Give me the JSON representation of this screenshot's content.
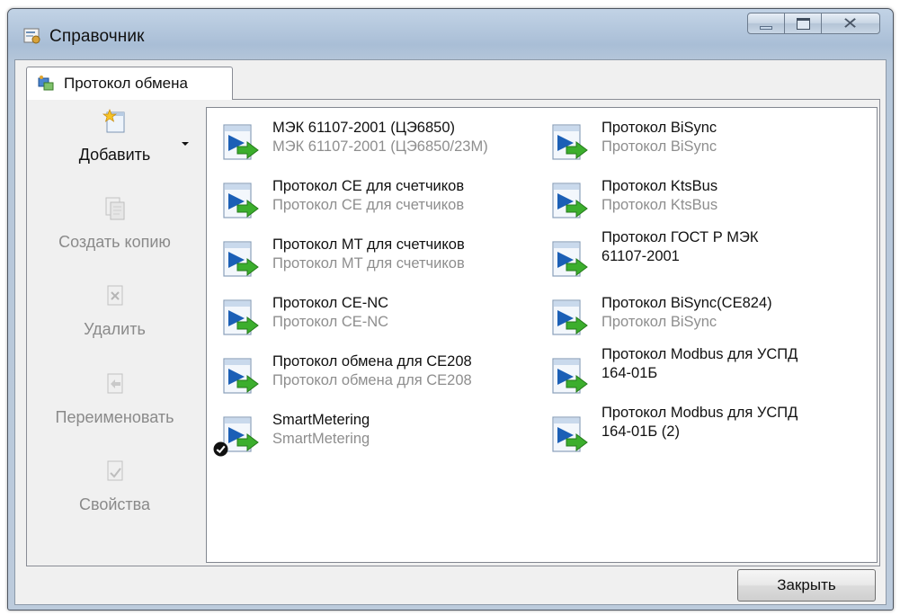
{
  "window": {
    "title": "Справочник",
    "controls": [
      "minimize",
      "maximize",
      "close"
    ]
  },
  "tab": {
    "label": "Протокол обмена"
  },
  "toolbar": [
    {
      "label": "Добавить",
      "icon": "new-item-icon",
      "enabled": true,
      "has_dropdown": true
    },
    {
      "label": "Создать копию",
      "icon": "copy-icon",
      "enabled": false
    },
    {
      "label": "Удалить",
      "icon": "delete-icon",
      "enabled": false
    },
    {
      "label": "Переименовать",
      "icon": "rename-icon",
      "enabled": false
    },
    {
      "label": "Свойства",
      "icon": "properties-icon",
      "enabled": false
    }
  ],
  "protocols": [
    {
      "title": "МЭК 61107-2001 (ЦЭ6850)",
      "subtitle": "МЭК 61107-2001 (ЦЭ6850/23М)",
      "active": false
    },
    {
      "title": "Протокол CE для счетчиков",
      "subtitle": "Протокол CE для счетчиков",
      "active": false
    },
    {
      "title": "Протокол MT для счетчиков",
      "subtitle": "Протокол MT для счетчиков",
      "active": false
    },
    {
      "title": "Протокол CE-NC",
      "subtitle": "Протокол CE-NC",
      "active": false
    },
    {
      "title": "Протокол обмена для CE208",
      "subtitle": "Протокол обмена для CE208",
      "active": false
    },
    {
      "title": "SmartMetering",
      "subtitle": "SmartMetering",
      "active": true
    },
    {
      "title": "Протокол BiSync",
      "subtitle": "Протокол BiSync",
      "active": false
    },
    {
      "title": "Протокол KtsBus",
      "subtitle": "Протокол KtsBus",
      "active": false
    },
    {
      "title": "Протокол ГОСТ Р МЭК 61107-2001",
      "subtitle": "",
      "active": false
    },
    {
      "title": "Протокол BiSync(CE824)",
      "subtitle": "Протокол BiSync",
      "active": false
    },
    {
      "title": "Протокол Modbus для УСПД 164-01Б",
      "subtitle": "",
      "active": false
    },
    {
      "title": "Протокол Modbus для УСПД 164-01Б (2)",
      "subtitle": "",
      "active": false
    }
  ],
  "footer": {
    "close_label": "Закрыть"
  },
  "colors": {
    "disabled_text": "#8a8a8a",
    "subtitle_text": "#8e8e8e",
    "arrow_green": "#3cae2d",
    "doc_blue": "#1b5fb6"
  }
}
